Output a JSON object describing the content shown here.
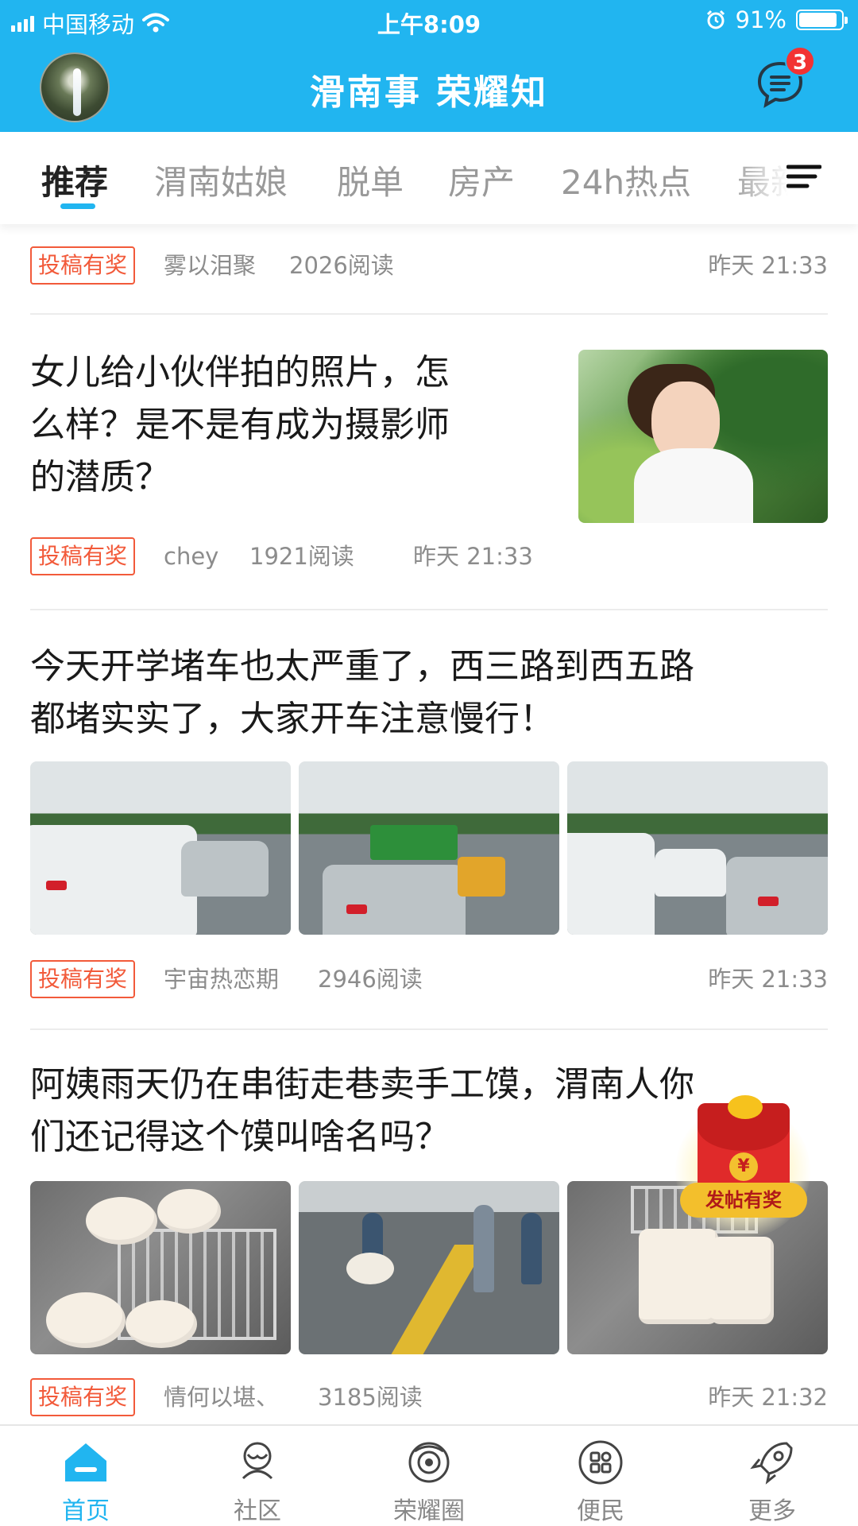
{
  "status_bar": {
    "carrier": "中国移动",
    "time": "上午8:09",
    "battery": "91%",
    "battery_level": 0.91
  },
  "header": {
    "title": "滑南事  荣耀知",
    "unread_count": "3"
  },
  "tabs": [
    {
      "label": "推荐",
      "active": true
    },
    {
      "label": "渭南姑娘"
    },
    {
      "label": "脱单"
    },
    {
      "label": "房产"
    },
    {
      "label": "24h热点"
    },
    {
      "label": "最新"
    }
  ],
  "feed": [
    {
      "tag": "投稿有奖",
      "author": "雾以泪聚",
      "reads": "2026阅读",
      "time": "昨天 21:33"
    },
    {
      "title_lines": [
        "女儿给小伙伴拍的照片，怎",
        "么样？是不是有成为摄影师",
        "的潜质？"
      ],
      "tag": "投稿有奖",
      "author": "chey",
      "reads": "1921阅读",
      "time": "昨天 21:33"
    },
    {
      "title_lines": [
        "今天开学堵车也太严重了，西三路到西五路",
        "都堵实实了，大家开车注意慢行！"
      ],
      "tag": "投稿有奖",
      "author": "宇宙热恋期",
      "reads": "2946阅读",
      "time": "昨天 21:33"
    },
    {
      "title_lines": [
        "阿姨雨天仍在串街走巷卖手工馍，渭南人你",
        "们还记得这个馍叫啥名吗？"
      ],
      "tag": "投稿有奖",
      "author": "情何以堪、",
      "reads": "3185阅读",
      "time": "昨天 21:32"
    }
  ],
  "promo": {
    "label": "发帖有奖",
    "symbol": "¥"
  },
  "bottom_nav": [
    {
      "label": "首页",
      "icon": "home-icon",
      "active": true
    },
    {
      "label": "社区",
      "icon": "community-icon"
    },
    {
      "label": "荣耀圈",
      "icon": "circle-icon"
    },
    {
      "label": "便民",
      "icon": "services-grid-icon"
    },
    {
      "label": "更多",
      "icon": "rocket-icon"
    }
  ],
  "colors": {
    "brand": "#21b5f0",
    "tag": "#f25a3a",
    "badge": "#f23333"
  }
}
